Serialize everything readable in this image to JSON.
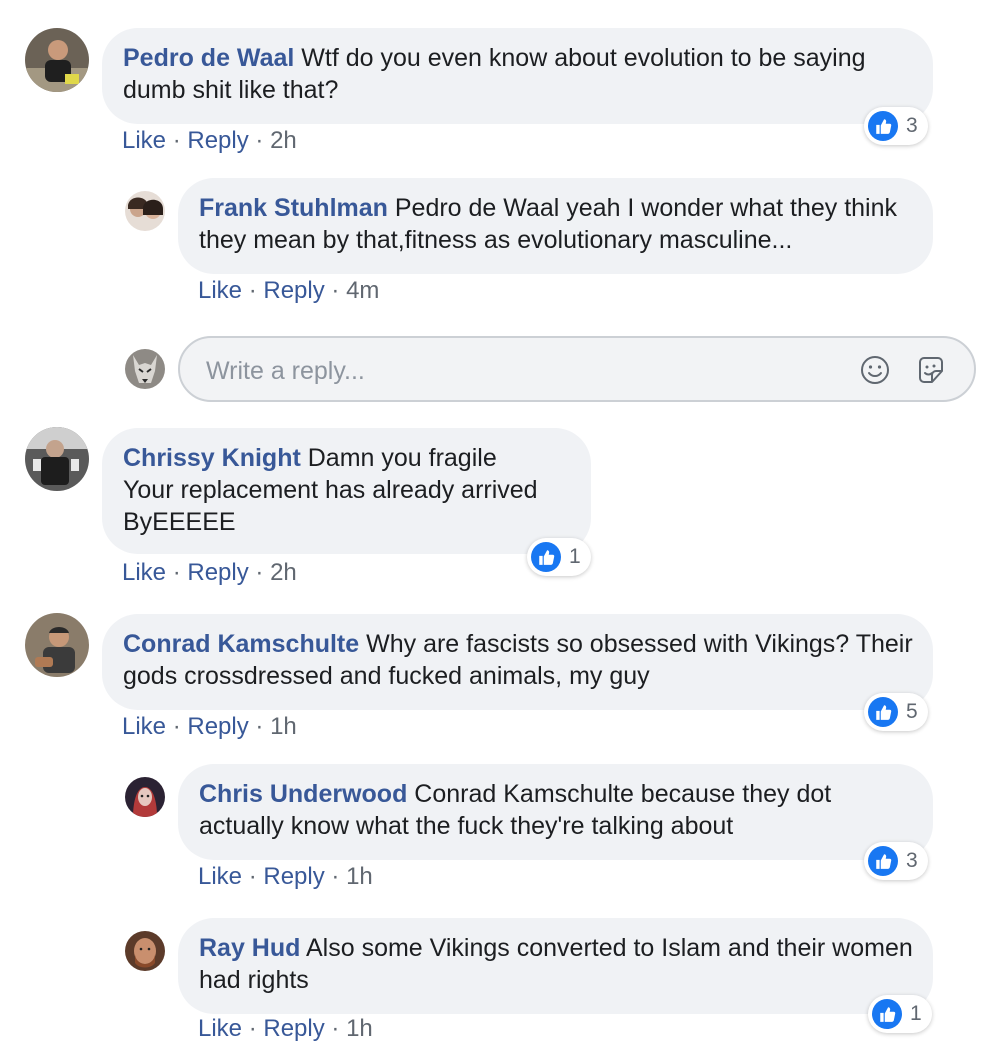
{
  "comments": [
    {
      "author": "Pedro de Waal",
      "text": "Wtf do you even know about evolution to be saying dumb shit like that?",
      "like": "Like",
      "reply": "Reply",
      "time": "2h",
      "reactions": "3",
      "replies": [
        {
          "author": "Frank Stuhlman",
          "text": "Pedro de Waal yeah I wonder what they think they mean by that,fitness as evolutionary masculine...",
          "like": "Like",
          "reply": "Reply",
          "time": "4m"
        }
      ]
    },
    {
      "author": "Chrissy Knight",
      "text_lines": [
        "Damn you fragile",
        "Your replacement has already arrived",
        "ByEEEEE"
      ],
      "like": "Like",
      "reply": "Reply",
      "time": "2h",
      "reactions": "1"
    },
    {
      "author": "Conrad Kamschulte",
      "text": "Why are fascists so obsessed with Vikings? Their gods crossdressed and fucked animals, my guy",
      "like": "Like",
      "reply": "Reply",
      "time": "1h",
      "reactions": "5",
      "replies": [
        {
          "author": "Chris Underwood",
          "text": "Conrad Kamschulte because they dot actually know what the fuck they're talking about",
          "like": "Like",
          "reply": "Reply",
          "time": "1h",
          "reactions": "3"
        },
        {
          "author": "Ray Hud",
          "text": "Also some Vikings converted to Islam and their women had rights",
          "like": "Like",
          "reply": "Reply",
          "time": "1h",
          "reactions": "1"
        }
      ]
    }
  ],
  "reply_box": {
    "placeholder": "Write a reply..."
  },
  "separator": "·",
  "icons": {
    "like_reaction": "thumbs-up-icon",
    "emoji": "smiley-icon",
    "sticker": "sticker-icon"
  },
  "colors": {
    "author": "#385898",
    "bubble": "#f0f2f5",
    "like_blue": "#1877f2",
    "meta_gray": "#606770"
  }
}
